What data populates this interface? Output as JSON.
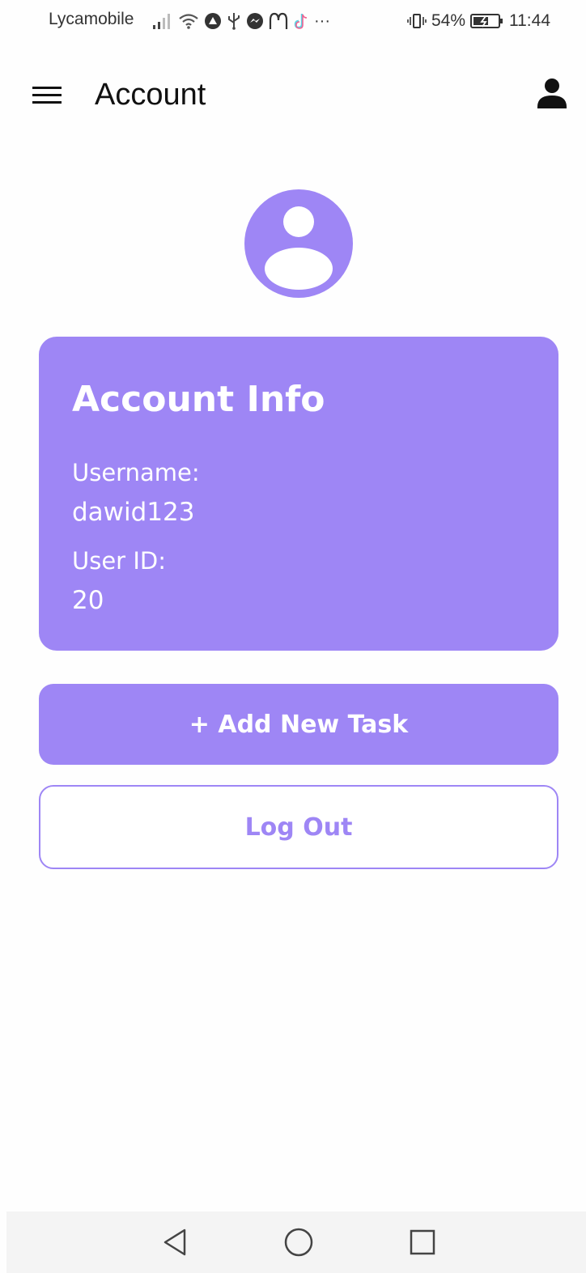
{
  "status_bar": {
    "carrier": "Lycamobile",
    "battery": "54%",
    "time": "11:44",
    "overflow": "···"
  },
  "header": {
    "title": "Account",
    "menu_icon": "hamburger-menu-icon",
    "account_icon": "person-icon"
  },
  "account_card": {
    "title": "Account Info",
    "username_label": "Username:",
    "username_value": "dawid123",
    "user_id_label": "User ID:",
    "user_id_value": "20"
  },
  "actions": {
    "add_task_label": "+ Add New Task",
    "logout_label": "Log Out"
  },
  "colors": {
    "accent": "#9e86f5",
    "text_on_accent": "#ffffff",
    "nav_bar": "#f4f4f4"
  }
}
